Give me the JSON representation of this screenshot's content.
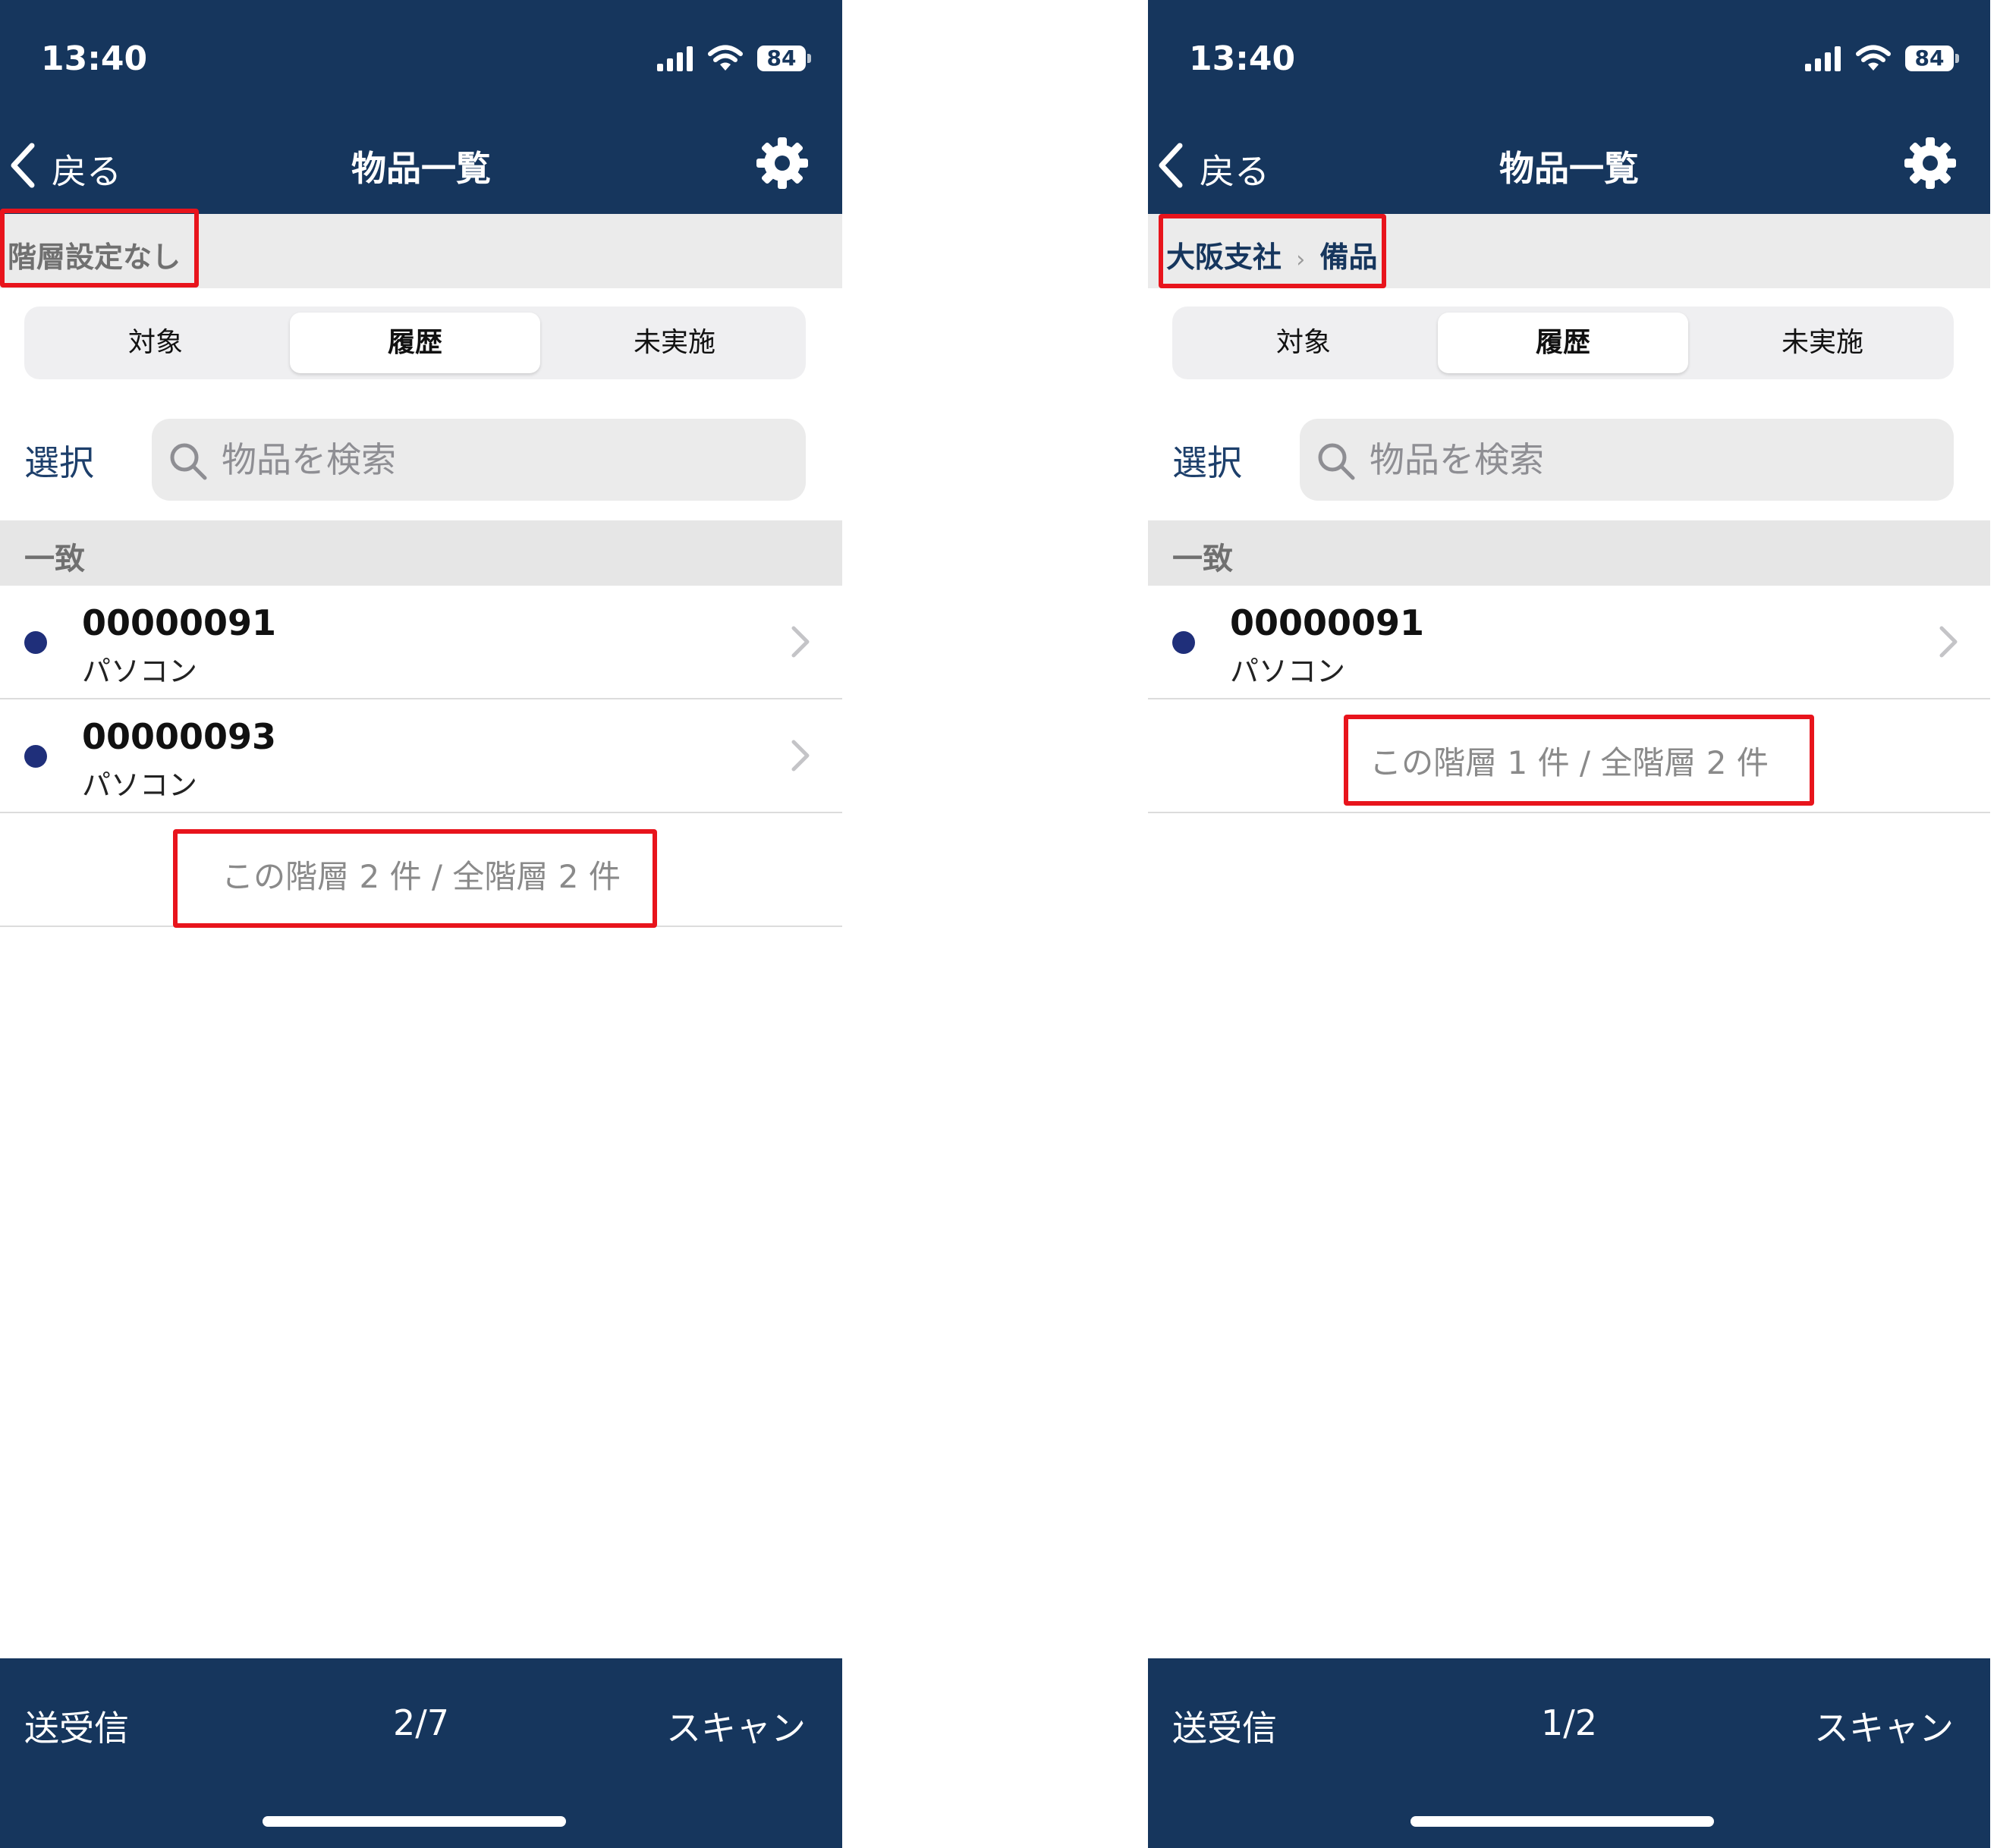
{
  "screens": [
    {
      "status": {
        "time": "13:40",
        "battery": "84"
      },
      "nav": {
        "back_label": "戻る",
        "title": "物品一覧"
      },
      "hierarchy": {
        "label": "階層設定なし"
      },
      "tabs": [
        {
          "label": "対象"
        },
        {
          "label": "履歴",
          "selected": true
        },
        {
          "label": "未実施"
        }
      ],
      "select_label": "選択",
      "search": {
        "placeholder": "物品を検索",
        "value": ""
      },
      "section_header": "一致",
      "items": [
        {
          "code": "00000091",
          "name": "パソコン"
        },
        {
          "code": "00000093",
          "name": "パソコン"
        }
      ],
      "count_text": "この階層 2 件 / 全階層 2 件",
      "toolbar": {
        "left": "送受信",
        "center": "2/7",
        "right": "スキャン"
      }
    },
    {
      "status": {
        "time": "13:40",
        "battery": "84"
      },
      "nav": {
        "back_label": "戻る",
        "title": "物品一覧"
      },
      "hierarchy": {
        "path": [
          "大阪支社",
          "備品"
        ]
      },
      "tabs": [
        {
          "label": "対象"
        },
        {
          "label": "履歴",
          "selected": true
        },
        {
          "label": "未実施"
        }
      ],
      "select_label": "選択",
      "search": {
        "placeholder": "物品を検索",
        "value": ""
      },
      "section_header": "一致",
      "items": [
        {
          "code": "00000091",
          "name": "パソコン"
        }
      ],
      "count_text": "この階層 1 件 / 全階層 2 件",
      "toolbar": {
        "left": "送受信",
        "center": "1/2",
        "right": "スキャン"
      }
    }
  ],
  "colors": {
    "nav_bar": "#16365d",
    "highlight": "#e8141c",
    "status_dot": "#1f2f7a",
    "link_text": "#1d3f6b"
  },
  "icons": [
    "signal-icon",
    "wifi-icon",
    "battery-icon",
    "back-chevron-icon",
    "gear-icon",
    "search-icon",
    "chevron-right-icon"
  ]
}
